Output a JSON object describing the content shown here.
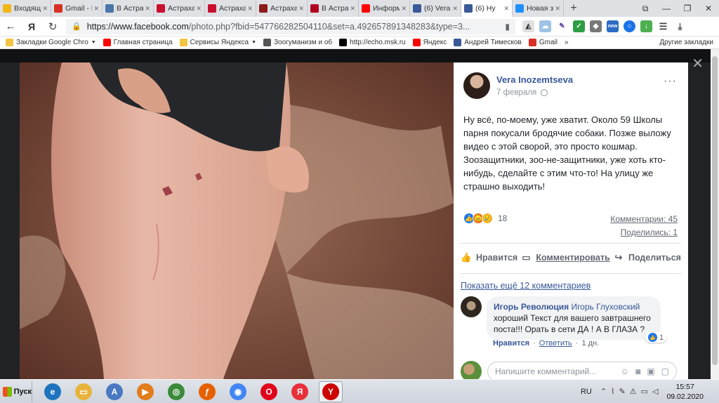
{
  "browser": {
    "tabs": [
      {
        "title": "Входящи",
        "icon": "yandex-mail-icon",
        "color": "#f2b619"
      },
      {
        "title": "Gmail - В",
        "icon": "gmail-icon",
        "color": "#d93025"
      },
      {
        "title": "В Астрах",
        "icon": "vk-icon",
        "color": "#4a76a8"
      },
      {
        "title": "Астрахан",
        "icon": "news-icon",
        "color": "#c8102e"
      },
      {
        "title": "Астрахан",
        "icon": "news-icon",
        "color": "#c8102e"
      },
      {
        "title": "Астрахан",
        "icon": "news-icon",
        "color": "#8b1a1a"
      },
      {
        "title": "В Астрах",
        "icon": "ap-icon",
        "color": "#b00020"
      },
      {
        "title": "Информ",
        "icon": "yandex-icon",
        "color": "#ff0000"
      },
      {
        "title": "(6) Vera",
        "icon": "facebook-icon",
        "color": "#3b5998"
      },
      {
        "title": "(6) Ну",
        "icon": "facebook-icon",
        "color": "#3b5998",
        "active": true
      },
      {
        "title": "Новая за",
        "icon": "yandex-browser-icon",
        "color": "#1e90ff"
      }
    ],
    "new_tab": "+",
    "url_host": "https://www.facebook.com",
    "url_path": "/photo.php?fbid=547766282504110&set=a.492657891348283&type=3...",
    "yandex_button": "Я",
    "bookmarks": [
      {
        "label": "Закладки Google Chro",
        "caret": true
      },
      {
        "label": "Главная страница",
        "icon_color": "#ff0000"
      },
      {
        "label": "Сервисы Яндекса",
        "caret": true
      },
      {
        "label": "Зоогуманизм и об",
        "icon_color": "#555"
      },
      {
        "label": "http://echo.msk.ru",
        "icon_color": "#000"
      },
      {
        "label": "Яндекс",
        "icon_color": "#ff0000"
      },
      {
        "label": "Андрей Тимесков",
        "icon_color": "#3b5998"
      },
      {
        "label": "Gmail",
        "icon_color": "#d93025"
      }
    ],
    "bookmarks_more": "»",
    "other_bookmarks": "Другие закладки"
  },
  "post": {
    "author": "Vera Inozemtseva",
    "date": "7 февраля",
    "more": "···",
    "text": "Ну всё, по-моему, уже хватит. Около 59 Школы парня покусали бродячие собаки. Позже выложу видео с этой сворой, это просто кошмар. Зоозащитники, зоо-не-защитники, уже хоть кто-нибудь, сделайте с этим что-то! На улицу же страшно выходить!",
    "reactions_count": "18",
    "comments_count": "Комментарии: 45",
    "shares_count": "Поделились: 1",
    "like_label": "Нравится",
    "comment_label": "Комментировать",
    "share_label": "Поделиться",
    "show_more": "Показать ещё 12 комментариев"
  },
  "comment": {
    "author": "Игорь Революция",
    "mention": "Игорь Глуховский",
    "text": "хороший Текст для вашего завтрашнего поста!!! Орать в сети ДА ! А В ГЛАЗА ?",
    "like_label": "Нравится",
    "reply_label": "Ответить",
    "time": "1 дн.",
    "reaction_count": "1"
  },
  "reply": {
    "placeholder": "Напишите комментарий..."
  },
  "taskbar": {
    "start_label": "Пуск",
    "apps": [
      {
        "name": "ie-icon",
        "color": "#1e73be",
        "glyph": "e"
      },
      {
        "name": "explorer-icon",
        "color": "#e8b33d",
        "glyph": "▭"
      },
      {
        "name": "notepad-icon",
        "color": "#4a78c2",
        "glyph": "A"
      },
      {
        "name": "media-player-icon",
        "color": "#e37c1b",
        "glyph": "▶"
      },
      {
        "name": "network-icon",
        "color": "#3a8a3a",
        "glyph": "◎"
      },
      {
        "name": "firefox-icon",
        "color": "#e66000",
        "glyph": "ƒ"
      },
      {
        "name": "chrome-icon",
        "color": "#4285f4",
        "glyph": "◉"
      },
      {
        "name": "opera-icon",
        "color": "#e0001b",
        "glyph": "O"
      },
      {
        "name": "yandex-icon",
        "color": "#e8303a",
        "glyph": "Я"
      },
      {
        "name": "yandex-browser-icon",
        "color": "#cc0000",
        "glyph": "Y"
      }
    ],
    "lang": "RU",
    "time": "15:57",
    "date": "09.02.2020"
  }
}
